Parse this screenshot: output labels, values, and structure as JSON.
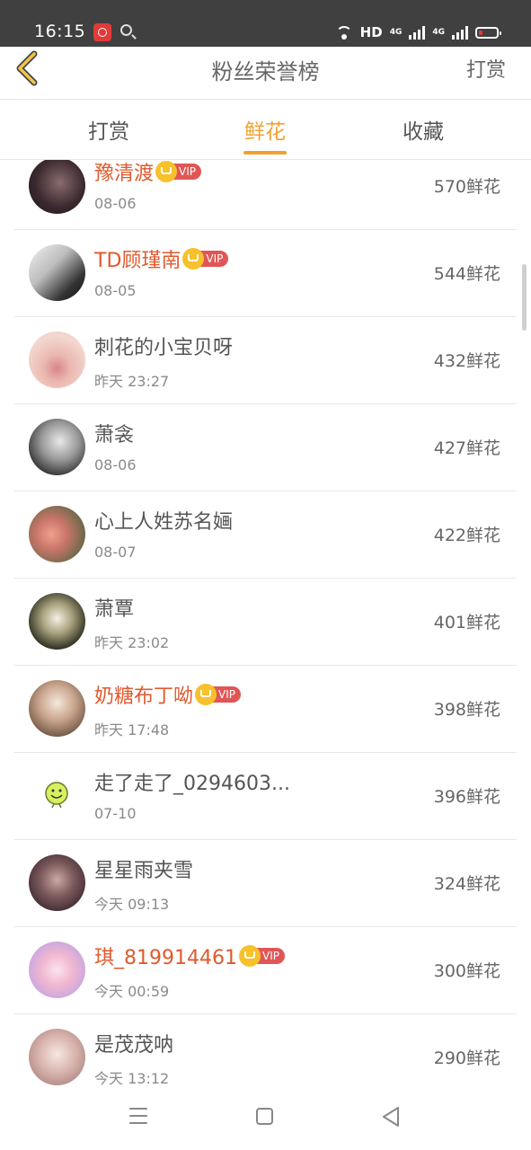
{
  "status_bar": {
    "time": "16:15",
    "network_label": "HD",
    "network_type_1": "4G",
    "network_type_2": "4G"
  },
  "header": {
    "title": "粉丝荣誉榜",
    "action": "打赏"
  },
  "tabs": [
    {
      "label": "打赏",
      "active": false
    },
    {
      "label": "鲜花",
      "active": true
    },
    {
      "label": "收藏",
      "active": false
    }
  ],
  "colors": {
    "accent": "#f2a12f",
    "vip_name": "#e05a2e",
    "vip_badge": "#e05656"
  },
  "rows": [
    {
      "name": "豫清渡",
      "vip": true,
      "vip_label": "VIP",
      "date": "08-06",
      "count": "570鲜花"
    },
    {
      "name": "TD顾瑾南",
      "vip": true,
      "vip_label": "VIP",
      "date": "08-05",
      "count": "544鲜花"
    },
    {
      "name": "刺花的小宝贝呀",
      "vip": false,
      "date": "昨天 23:27",
      "count": "432鲜花"
    },
    {
      "name": "萧衾",
      "vip": false,
      "date": "08-06",
      "count": "427鲜花"
    },
    {
      "name": "心上人姓苏名婳",
      "vip": false,
      "date": "08-07",
      "count": "422鲜花"
    },
    {
      "name": "萧覃",
      "vip": false,
      "date": "昨天 23:02",
      "count": "401鲜花"
    },
    {
      "name": "奶糖布丁呦",
      "vip": true,
      "vip_label": "VIP",
      "date": "昨天 17:48",
      "count": "398鲜花"
    },
    {
      "name": "走了走了_0294603...",
      "vip": false,
      "date": "07-10",
      "count": "396鲜花"
    },
    {
      "name": "星星雨夹雪",
      "vip": false,
      "date": "今天 09:13",
      "count": "324鲜花"
    },
    {
      "name": "琪_819914461",
      "vip": true,
      "vip_label": "VIP",
      "date": "今天 00:59",
      "count": "300鲜花"
    },
    {
      "name": "是茂茂呐",
      "vip": false,
      "date": "今天 13:12",
      "count": "290鲜花"
    }
  ],
  "icons": [
    "back-chevron-icon",
    "crown-icon",
    "menu-icon",
    "home-icon",
    "back-triangle-icon"
  ]
}
